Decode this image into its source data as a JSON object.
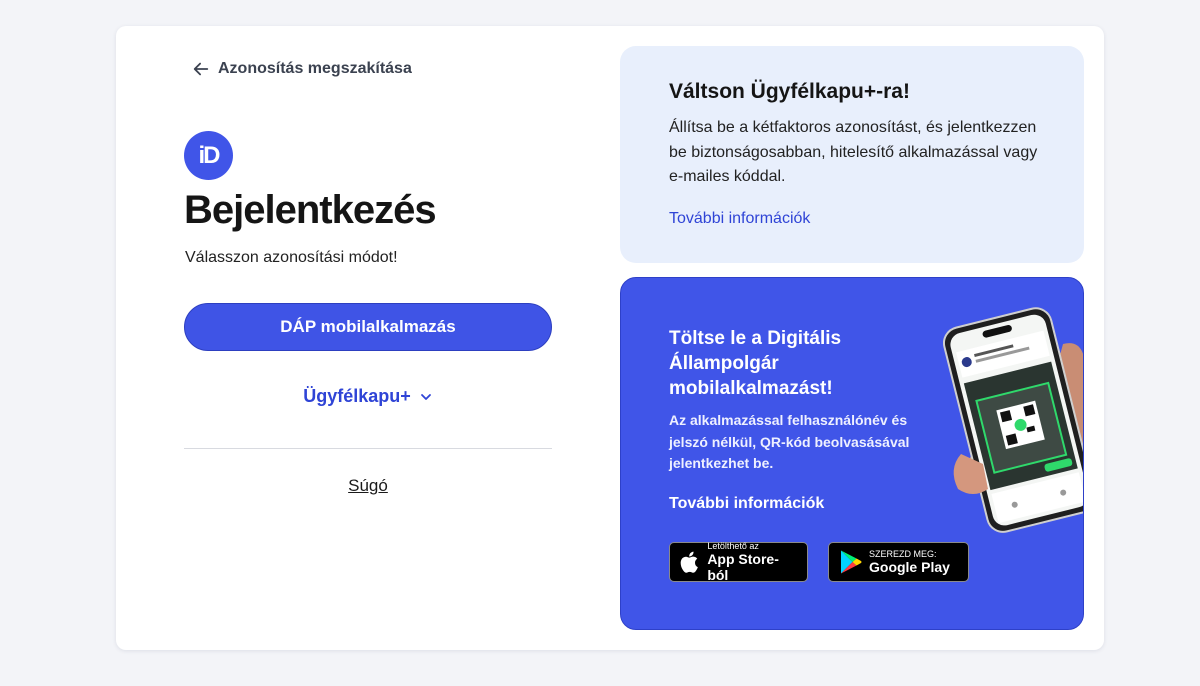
{
  "left": {
    "back_label": "Azonosítás megszakítása",
    "logo_text": "iD",
    "title": "Bejelentkezés",
    "subtitle": "Válasszon azonosítási módot!",
    "primary_button": "DÁP mobilalkalmazás",
    "secondary_option": "Ügyfélkapu+",
    "help_link": "Súgó"
  },
  "info_panel": {
    "title": "Váltson Ügyfélkapu+-ra!",
    "text": "Állítsa be a kétfaktoros azonosítást, és jelentkezzen be biztonságosabban, hitelesítő alkalmazással vagy e-mailes kóddal.",
    "link": "További információk"
  },
  "promo_panel": {
    "title": "Töltse le a Digitális Állampolgár mobilalkalmazást!",
    "text": "Az alkalmazással felhasználónév és jelszó nélkül, QR-kód beolvasásával jelentkezhet be.",
    "link": "További információk",
    "app_store": {
      "small": "Letölthető az",
      "big": "App Store-ból"
    },
    "google_play": {
      "small": "SZEREZD MEG:",
      "big": "Google Play"
    }
  },
  "colors": {
    "accent": "#4055e8",
    "link": "#2f44d6",
    "info_bg": "#e8effc",
    "page_bg": "#f3f4f8"
  }
}
